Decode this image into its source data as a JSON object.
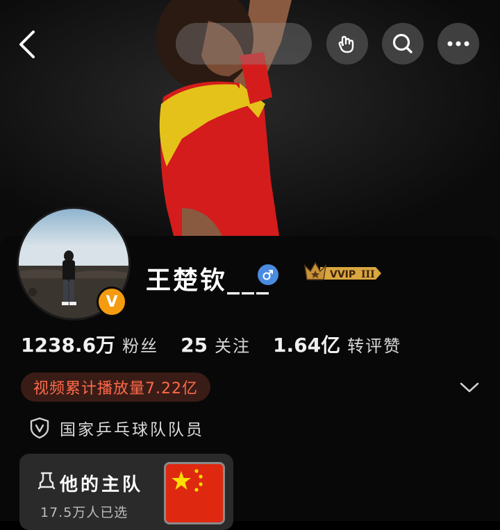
{
  "profile": {
    "name": "王楚钦___",
    "gender_icon": "male-icon",
    "verified_badge": "V",
    "vip_label": "VVIP",
    "vip_level": "III",
    "colors": {
      "verified_badge": "#f49b0f",
      "gender_badge": "#4a8be0",
      "vip_gold": "#d9a640",
      "plays_text": "#ff6a4a",
      "plays_bg": "#3a1c16"
    }
  },
  "stats": [
    {
      "value": "1238.6万",
      "label": "粉丝"
    },
    {
      "value": "25",
      "label": "关注"
    },
    {
      "value": "1.64亿",
      "label": "转评赞"
    }
  ],
  "plays": {
    "text": "视频累计播放量7.22亿"
  },
  "certification": {
    "icon": "shield-v-icon",
    "text": "国家乒乓球队队员"
  },
  "team": {
    "icon": "team-icon",
    "title": "他的主队",
    "subtitle": "17.5万人已选",
    "flag": "china-flag"
  },
  "topbar": {
    "icons": [
      "back-icon",
      "hand-icon",
      "search-icon",
      "more-icon"
    ]
  }
}
